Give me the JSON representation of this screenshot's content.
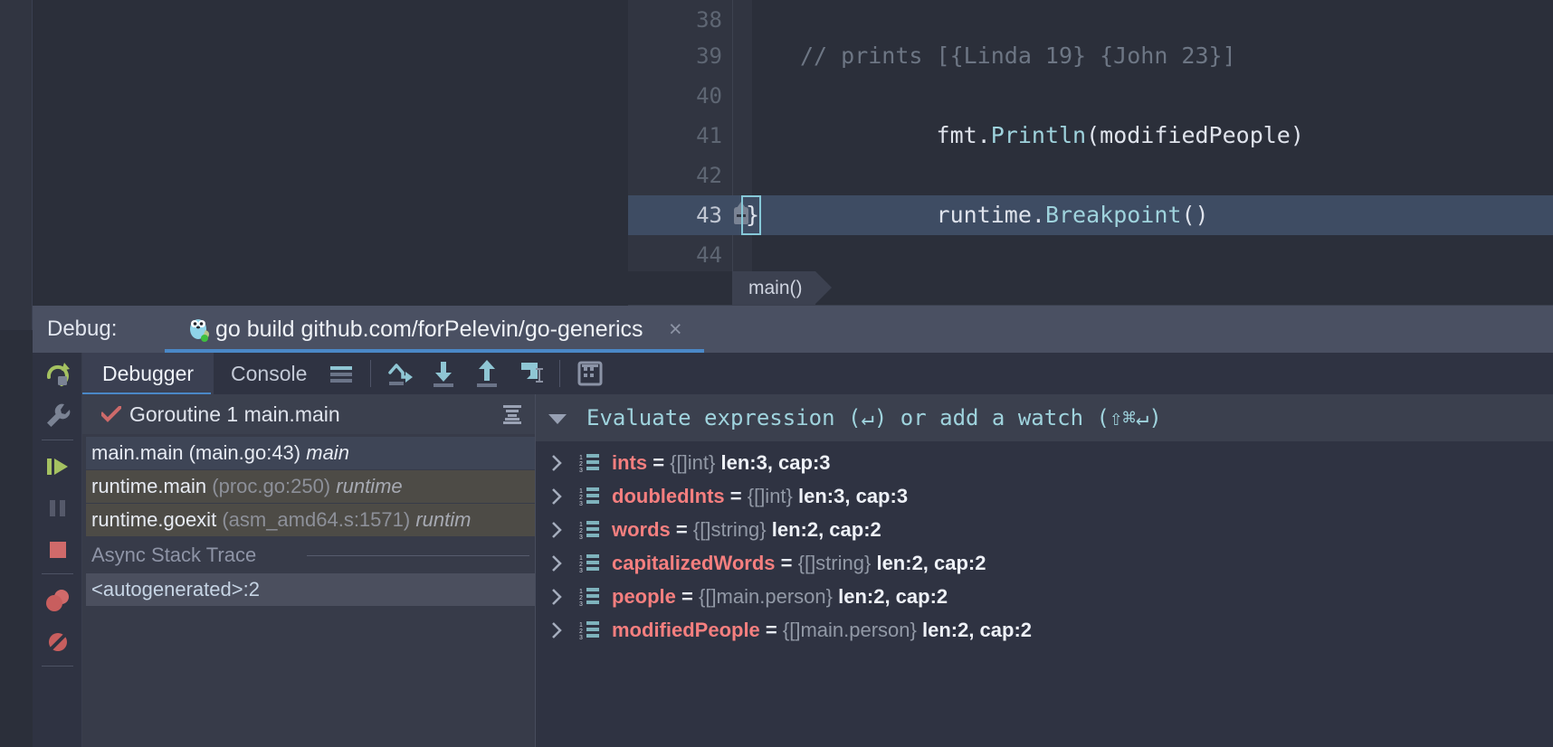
{
  "editor": {
    "lines": [
      {
        "no": "38",
        "segments": []
      },
      {
        "no": "39",
        "comment": "// prints [{Linda 19} {John 23}]"
      },
      {
        "no": "40",
        "pre": "fmt.",
        "fn": "Println",
        "post": "(modifiedPeople)"
      },
      {
        "no": "41",
        "segments": []
      },
      {
        "no": "42",
        "pre": "runtime.",
        "fn": "Breakpoint",
        "post": "()"
      },
      {
        "no": "43",
        "plain": "}",
        "current": true
      },
      {
        "no": "44",
        "segments": []
      }
    ],
    "line38": "",
    "line39": "// prints [{Linda 19} {John 23}]",
    "line40_pre": "fmt.",
    "line40_fn": "Println",
    "line40_post": "(modifiedPeople)",
    "line41": "",
    "line42_pre": "runtime.",
    "line42_fn": "Breakpoint",
    "line42_post": "()",
    "line43": "}",
    "line44": "",
    "lineno_38": "38",
    "lineno_39": "39",
    "lineno_40": "40",
    "lineno_41": "41",
    "lineno_42": "42",
    "lineno_43": "43",
    "lineno_44": "44",
    "breadcrumb": "main()"
  },
  "debug_header": {
    "label": "Debug:",
    "title": "go build github.com/forPelevin/go-generics",
    "close": "×",
    "go_icon": "go-gopher-icon"
  },
  "left_rail": {
    "items": [
      {
        "name": "rerun-icon"
      },
      {
        "name": "settings-wrench-icon"
      },
      {
        "name": "resume-program-icon"
      },
      {
        "name": "pause-program-icon"
      },
      {
        "name": "stop-icon"
      },
      {
        "name": "view-breakpoints-icon"
      },
      {
        "name": "mute-breakpoints-icon"
      }
    ]
  },
  "debug_toolbar": {
    "tabs": [
      {
        "label": "Debugger",
        "active": true
      },
      {
        "label": "Console",
        "active": false
      }
    ],
    "icons": [
      {
        "name": "show-execution-point-icon"
      },
      {
        "name": "step-over-icon"
      },
      {
        "name": "step-into-icon"
      },
      {
        "name": "step-out-icon"
      },
      {
        "name": "force-step-into-icon"
      },
      {
        "name": "evaluate-expression-icon"
      }
    ]
  },
  "frames": {
    "goroutine_label": "Goroutine 1 main.main",
    "goroutine_status_icon": "check-icon",
    "frames_list_icon": "stack-frames-icon",
    "items": [
      {
        "fn": "main.main",
        "loc": "(main.go:43)",
        "pkg": "main",
        "selected": true,
        "bright_pkg": true
      },
      {
        "fn": "runtime.main",
        "loc": "(proc.go:250)",
        "pkg": "runtime",
        "selected": false,
        "bright_pkg": false
      },
      {
        "fn": "runtime.goexit",
        "loc": "(asm_amd64.s:1571)",
        "pkg": "runtim",
        "selected": false,
        "bright_pkg": false
      }
    ],
    "async_header": "Async Stack Trace",
    "async_item": "<autogenerated>:2"
  },
  "variables": {
    "eval_hint": "Evaluate expression (↵) or add a watch (⇧⌘↵)",
    "rows": [
      {
        "name": "ints",
        "type": "{[]int}",
        "meta": "len:3, cap:3"
      },
      {
        "name": "doubledInts",
        "type": "{[]int}",
        "meta": "len:3, cap:3"
      },
      {
        "name": "words",
        "type": "{[]string}",
        "meta": "len:2, cap:2"
      },
      {
        "name": "capitalizedWords",
        "type": "{[]string}",
        "meta": "len:2, cap:2"
      },
      {
        "name": "people",
        "type": "{[]main.person}",
        "meta": "len:2, cap:2"
      },
      {
        "name": "modifiedPeople",
        "type": "{[]main.person}",
        "meta": "len:2, cap:2"
      }
    ]
  },
  "colors": {
    "background": "#2b2f3a",
    "panel": "#2f3342",
    "header": "#4a5062",
    "accent_blue": "#4a88c7",
    "var_name_red": "#f57f7f",
    "keyword_cyan": "#9fd3dd",
    "selected_row": "#3e4c63"
  }
}
